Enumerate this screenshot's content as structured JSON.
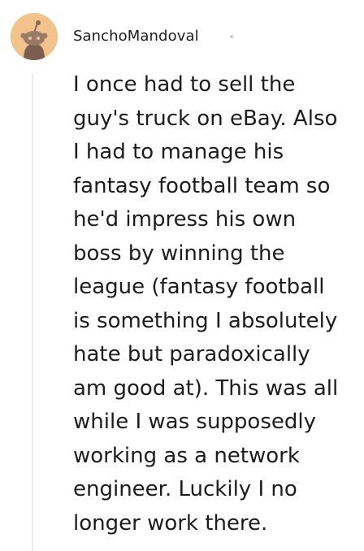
{
  "comment": {
    "username": "SanchoMandoval",
    "avatar": {
      "icon": "reddit-snoo-avatar-icon",
      "background_color": "#f2c48c"
    },
    "body_lines": [
      "I once had to sell the",
      "guy's truck on eBay. Also",
      "I had to manage his",
      "fantasy football team so",
      "he'd impress his own",
      "boss by winning the",
      "league (fantasy football",
      "is something I absolutely",
      "hate but paradoxically",
      "am good at). This was all",
      "while I was supposedly",
      "working as a network",
      "engineer. Luckily I no",
      "longer work there."
    ]
  }
}
